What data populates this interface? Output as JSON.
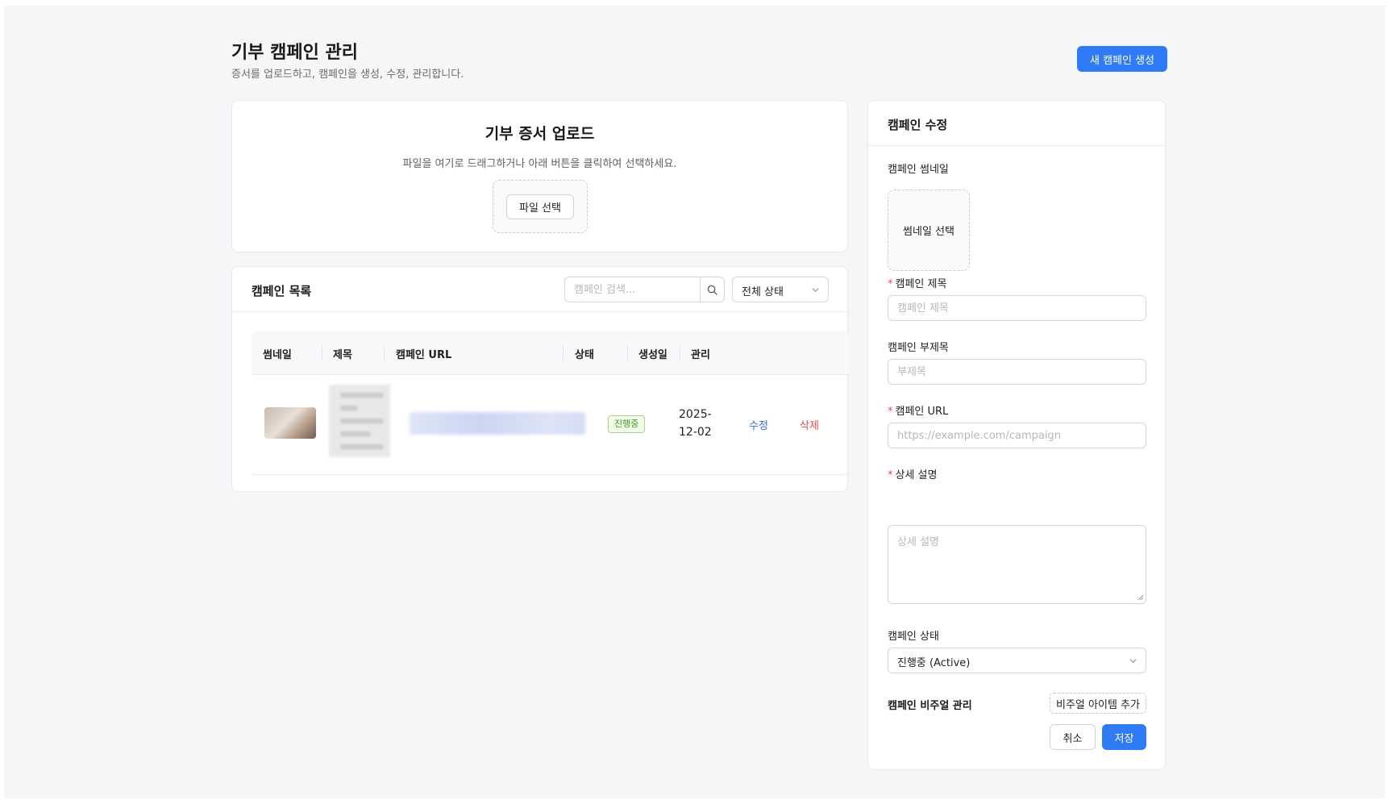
{
  "page": {
    "title": "기부 캠페인 관리",
    "subtitle": "증서를 업로드하고, 캠페인을 생성, 수정, 관리합니다.",
    "new_button": "새 캠페인 생성"
  },
  "upload": {
    "title": "기부 증서 업로드",
    "description": "파일을 여기로 드래그하거나 아래 버튼을 클릭하여 선택하세요.",
    "button": "파일 선택"
  },
  "list": {
    "title": "캠페인 목록",
    "search_placeholder": "캠페인 검색...",
    "status_filter": "전체 상태",
    "columns": [
      "썸네일",
      "제목",
      "캠페인 URL",
      "상태",
      "생성일",
      "관리"
    ],
    "rows": [
      {
        "status": "진행중",
        "created": "2025-12-02",
        "edit": "수정",
        "delete": "삭제"
      }
    ]
  },
  "edit": {
    "title": "캠페인 수정",
    "thumbnail_label": "캠페인 썸네일",
    "thumbnail_button": "썸네일 선택",
    "title_label": "캠페인 제목",
    "title_placeholder": "캠페인 제목",
    "subtitle_label": "캠페인 부제목",
    "subtitle_placeholder": "부제목",
    "url_label": "캠페인 URL",
    "url_placeholder": "https://example.com/campaign",
    "desc_label": "상세 설명",
    "desc_placeholder": "상세 설명",
    "status_label": "캠페인 상태",
    "status_value": "진행중 (Active)",
    "visual_label": "캠페인 비주얼 관리",
    "visual_button": "비주얼 아이템 추가",
    "cancel": "취소",
    "save": "저장"
  },
  "colors": {
    "primary": "#2f7bf5",
    "danger": "#e5484d",
    "link": "#2f6fe6",
    "success": "#3f9b1d"
  },
  "icons": [
    "search-icon",
    "chevron-down-icon",
    "resize-handle-icon"
  ]
}
